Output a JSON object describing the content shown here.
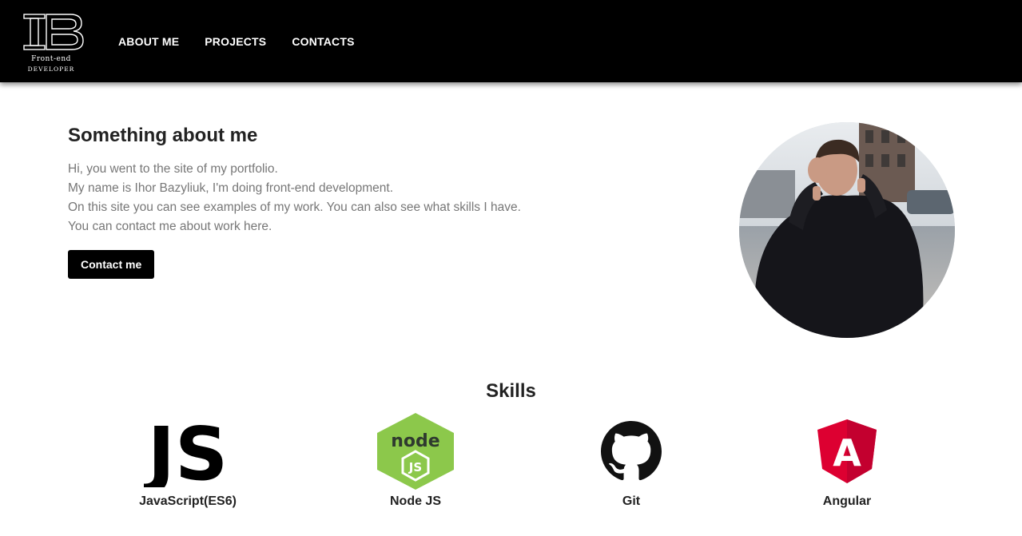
{
  "header": {
    "logo_line1": "Front-end",
    "logo_line2": "developer",
    "nav": [
      {
        "label": "ABOUT ME"
      },
      {
        "label": "PROJECTS"
      },
      {
        "label": "CONTACTS"
      }
    ]
  },
  "about": {
    "title": "Something about me",
    "lines": [
      "Hi, you went to the site of my portfolio.",
      "My name is Ihor Bazyliuk, I'm doing front-end development.",
      "On this site you can see examples of my work. You can also see what skills I have.",
      "You can contact me about work here."
    ],
    "button_label": "Contact me"
  },
  "skills": {
    "title": "Skills",
    "items": [
      {
        "label": "JavaScript(ES6)",
        "icon": "javascript-icon",
        "icon_text": "JS"
      },
      {
        "label": "Node JS",
        "icon": "nodejs-icon",
        "icon_text": "node",
        "icon_sub": "JS"
      },
      {
        "label": "Git",
        "icon": "github-icon"
      },
      {
        "label": "Angular",
        "icon": "angular-icon",
        "icon_text": "A"
      }
    ]
  },
  "colors": {
    "header_bg": "#000000",
    "button_bg": "#000000",
    "text_muted": "#777777",
    "node_green": "#8cc84b",
    "angular_red": "#dd0031"
  }
}
